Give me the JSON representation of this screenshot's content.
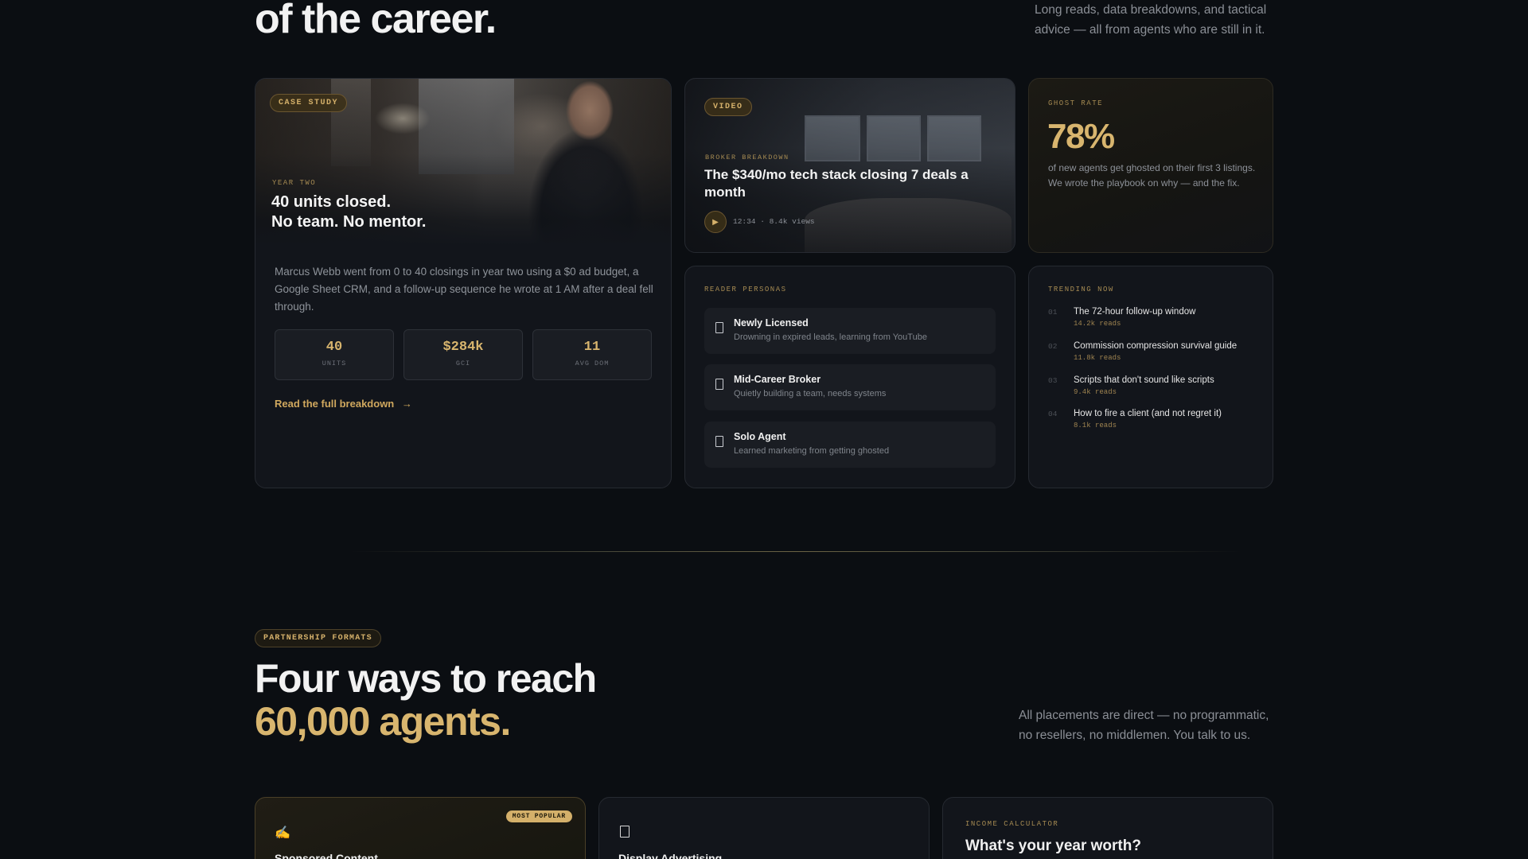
{
  "hero": {
    "title": "of the career.",
    "subtitle": "Long reads, data breakdowns, and tactical advice — all from agents who are still in it."
  },
  "case_study": {
    "tag": "CASE STUDY",
    "eyebrow": "YEAR TWO",
    "headline_line1": "40 units closed.",
    "headline_line2": "No team. No mentor.",
    "body": "Marcus Webb went from 0 to 40 closings in year two using a $0 ad budget, a Google Sheet CRM, and a follow-up sequence he wrote at 1 AM after a deal fell through.",
    "stats": [
      {
        "value": "40",
        "label": "UNITS"
      },
      {
        "value": "$284k",
        "label": "GCI"
      },
      {
        "value": "11",
        "label": "AVG DOM"
      }
    ],
    "link": "Read the full breakdown",
    "link_arrow": "→"
  },
  "video": {
    "tag": "VIDEO",
    "eyebrow": "BROKER BREAKDOWN",
    "title": "The $340/mo tech stack closing 7 deals a month",
    "play_icon": "▶",
    "meta": "12:34 · 8.4k views"
  },
  "ghost": {
    "eyebrow": "GHOST RATE",
    "value": "78%",
    "text": "of new agents get ghosted on their first 3 listings. We wrote the playbook on why — and the fix."
  },
  "personas": {
    "eyebrow": "READER PERSONAS",
    "items": [
      {
        "title": "Newly Licensed",
        "desc": "Drowning in expired leads, learning from YouTube"
      },
      {
        "title": "Mid-Career Broker",
        "desc": "Quietly building a team, needs systems"
      },
      {
        "title": "Solo Agent",
        "desc": "Learned marketing from getting ghosted"
      }
    ]
  },
  "trending": {
    "eyebrow": "TRENDING NOW",
    "items": [
      {
        "num": "01",
        "title": "The 72-hour follow-up window",
        "reads": "14.2k reads"
      },
      {
        "num": "02",
        "title": "Commission compression survival guide",
        "reads": "11.8k reads"
      },
      {
        "num": "03",
        "title": "Scripts that don't sound like scripts",
        "reads": "9.4k reads"
      },
      {
        "num": "04",
        "title": "How to fire a client (and not regret it)",
        "reads": "8.1k reads"
      }
    ]
  },
  "partnership": {
    "tag": "PARTNERSHIP FORMATS",
    "title_line1": "Four ways to reach",
    "title_line2": "60,000 agents.",
    "subtitle": "All placements are direct — no programmatic, no resellers, no middlemen. You talk to us.",
    "cards": [
      {
        "badge": "MOST POPULAR",
        "icon": "✍",
        "title": "Sponsored Content"
      },
      {
        "title": "Display Advertising"
      },
      {
        "eyebrow": "INCOME CALCULATOR",
        "title": "What's your year worth?"
      }
    ]
  },
  "colors": {
    "background": "#0b0e12",
    "accent_gold": "#d8b56e",
    "card": "#12151b"
  }
}
